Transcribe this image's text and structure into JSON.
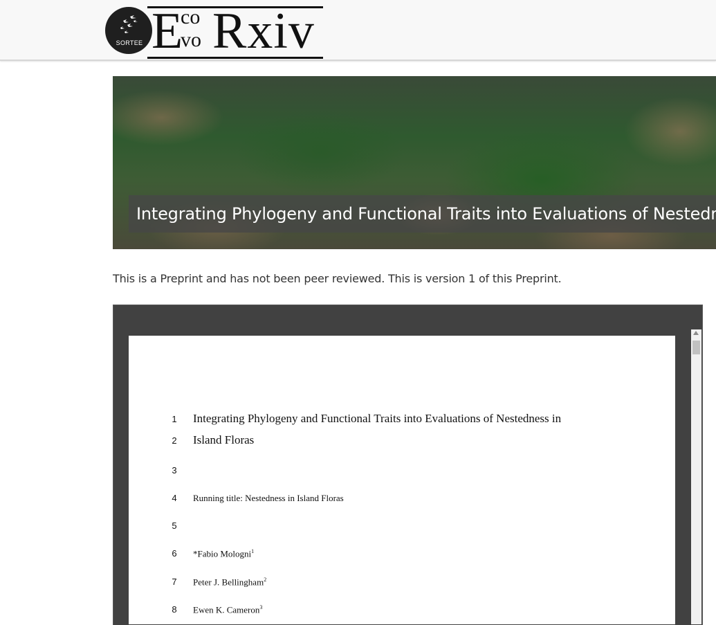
{
  "header": {
    "logo": {
      "badge_text": "SORTEE",
      "wordmark": {
        "E": "E",
        "co": "co",
        "vo": "vo",
        "rxiv": "Rxiv"
      },
      "icon": "birds-icon"
    }
  },
  "banner": {
    "title": "Integrating Phylogeny and Functional Traits into Evaluations of Nestedness in Island Floras"
  },
  "notice": "This is a Preprint and has not been peer reviewed. This is version 1 of this Preprint.",
  "pdf": {
    "lines": [
      {
        "n": "1",
        "text": "Integrating Phylogeny and Functional Traits into Evaluations of Nestedness in",
        "sup": ""
      },
      {
        "n": "2",
        "text": "Island Floras",
        "sup": ""
      },
      {
        "n": "3",
        "text": "",
        "sup": ""
      },
      {
        "n": "4",
        "text": "Running title: Nestedness in Island Floras",
        "sup": ""
      },
      {
        "n": "5",
        "text": "",
        "sup": ""
      },
      {
        "n": "6",
        "text": "*Fabio Mologni",
        "sup": "1"
      },
      {
        "n": "7",
        "text": "Peter J. Bellingham",
        "sup": "2"
      },
      {
        "n": "8",
        "text": "Ewen K. Cameron",
        "sup": "3"
      }
    ]
  },
  "colors": {
    "header_bg": "#f8f8f8",
    "viewer_bg": "#414141",
    "title_overlay": "#464646"
  }
}
